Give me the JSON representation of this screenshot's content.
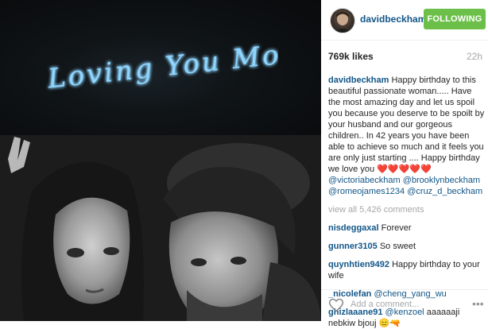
{
  "header": {
    "username": "davidbeckham",
    "follow_label": "FOLLOWING"
  },
  "photo": {
    "neon_text": "Loving You More."
  },
  "stats": {
    "likes": "769k likes",
    "time_ago": "22h"
  },
  "caption": {
    "user": "davidbeckham",
    "text": "Happy birthday to this beautiful passionate woman..... Have the most amazing day and let us spoil you because you deserve to be spoilt by your husband and our gorgeous children.. In 42 years you have been able to achieve so much and it feels you are only just starting .... Happy birthday we love you",
    "hearts": "❤️❤️❤️❤️❤️",
    "mention_1": "@victoriabeckham",
    "mention_2": "@brooklynbeckham",
    "mention_3": "@romeojames1234",
    "mention_4": "@cruz_d_beckham"
  },
  "view_all": "view all 5,426 comments",
  "comments": [
    {
      "user": "nisdeggaxal",
      "text": "Forever"
    },
    {
      "user": "gunner3105",
      "text": "So sweet"
    },
    {
      "user": "quynhtien9492",
      "text": "Happy birthday to your wife"
    },
    {
      "user": "_nicolefan",
      "mention": "@cheng_yang_wu",
      "text": ""
    },
    {
      "user": "ghizlaaane91",
      "mention": "@kenzoel",
      "text": "aaaaaaji nebkiw bjouj 😑🔫"
    }
  ],
  "footer": {
    "placeholder": "Add a comment...",
    "more": "•••"
  }
}
